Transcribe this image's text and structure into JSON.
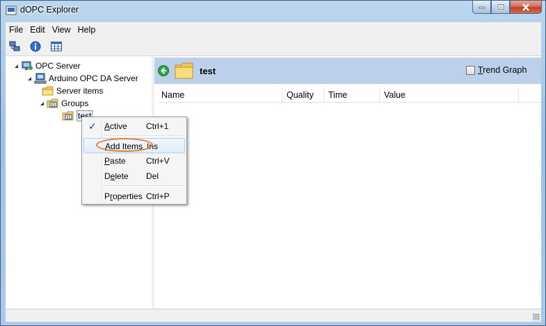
{
  "window": {
    "title": "dOPC Explorer",
    "accent_color": "#bcd0ea",
    "highlight_ring_color": "#e57f2a"
  },
  "menubar": {
    "items": [
      "File",
      "Edit",
      "View",
      "Help"
    ]
  },
  "toolbar": {
    "buttons": [
      "network-icon",
      "info-icon",
      "table-icon"
    ]
  },
  "tree": {
    "root": "OPC Server",
    "server": "Arduino OPC DA Server",
    "server_items": "Server items",
    "groups": "Groups",
    "group_test": "test"
  },
  "right_pane": {
    "title": "test",
    "trend_graph": {
      "prefix": "",
      "underlined": "T",
      "rest": "rend Graph",
      "checked": false
    },
    "columns": [
      "Name",
      "Quality",
      "Time",
      "Value"
    ]
  },
  "context_menu": {
    "items": [
      {
        "underlined": "A",
        "rest": "ctive",
        "shortcut": "Ctrl+1",
        "checked": true
      },
      {
        "underlined": "A",
        "rest": "dd Items",
        "shortcut": "Ins",
        "highlighted": true
      },
      {
        "underlined": "P",
        "rest": "aste",
        "shortcut": "Ctrl+V"
      },
      {
        "prefix": "D",
        "underlined": "e",
        "rest": "lete",
        "shortcut": "Del"
      },
      {
        "prefix": "P",
        "underlined": "r",
        "rest": "operties",
        "shortcut": "Ctrl+P"
      }
    ]
  }
}
